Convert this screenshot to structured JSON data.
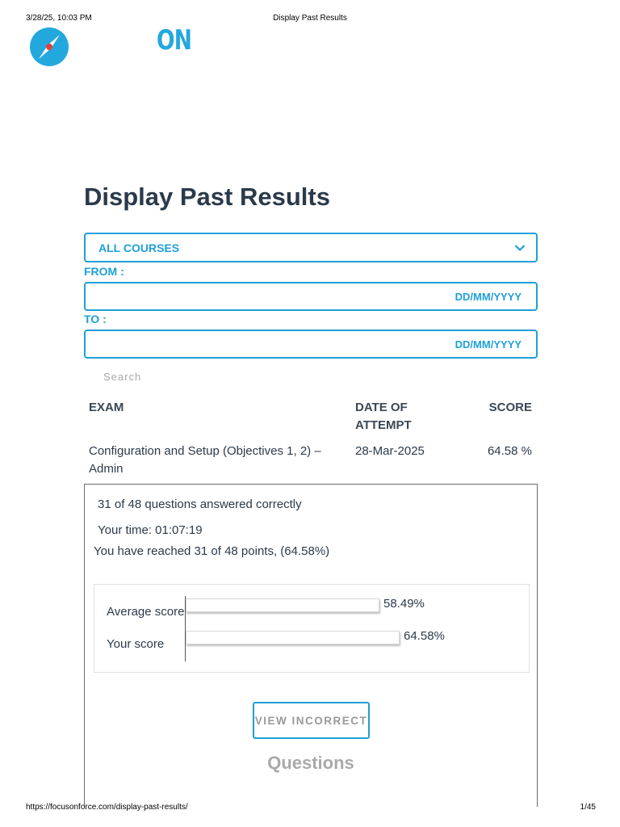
{
  "print_header": {
    "datetime": "3/28/25, 10:03 PM",
    "title": "Display Past Results"
  },
  "print_footer": {
    "url": "https://focusonforce.com/display-past-results/",
    "page": "1/45"
  },
  "logo": {
    "text": "ON",
    "color": "#23a8de"
  },
  "page": {
    "title": "Display Past Results"
  },
  "filters": {
    "course_select": {
      "value": "ALL COURSES"
    },
    "from": {
      "label": "FROM :",
      "placeholder": "DD/MM/YYYY"
    },
    "to": {
      "label": "TO :",
      "placeholder": "DD/MM/YYYY"
    },
    "search": {
      "placeholder": "Search"
    }
  },
  "table": {
    "headers": {
      "exam": "EXAM",
      "date_line1": "DATE OF",
      "date_line2": "ATTEMPT",
      "score": "SCORE"
    },
    "rows": [
      {
        "exam_line1": "Configuration and Setup (Objectives 1, 2) –",
        "exam_line2": "Admin",
        "date": "28-Mar-2025",
        "score": "64.58 %"
      }
    ]
  },
  "result": {
    "answered": "31 of 48 questions answered correctly",
    "time": "Your time: 01:07:19",
    "points": "You have reached 31 of 48 points, (64.58%)",
    "chart_data": {
      "type": "bar",
      "orientation": "horizontal",
      "categories": [
        "Average score",
        "Your score"
      ],
      "values": [
        58.49,
        64.58
      ],
      "value_labels": [
        "58.49%",
        "64.58%"
      ],
      "unit": "%",
      "xlim": [
        0,
        100
      ]
    },
    "view_incorrect_label": "VIEW INCORRECT",
    "questions_heading": "Questions"
  },
  "colors": {
    "accent": "#1ea0d8",
    "heading": "#2b3a4a",
    "muted": "#a9a9a9"
  }
}
